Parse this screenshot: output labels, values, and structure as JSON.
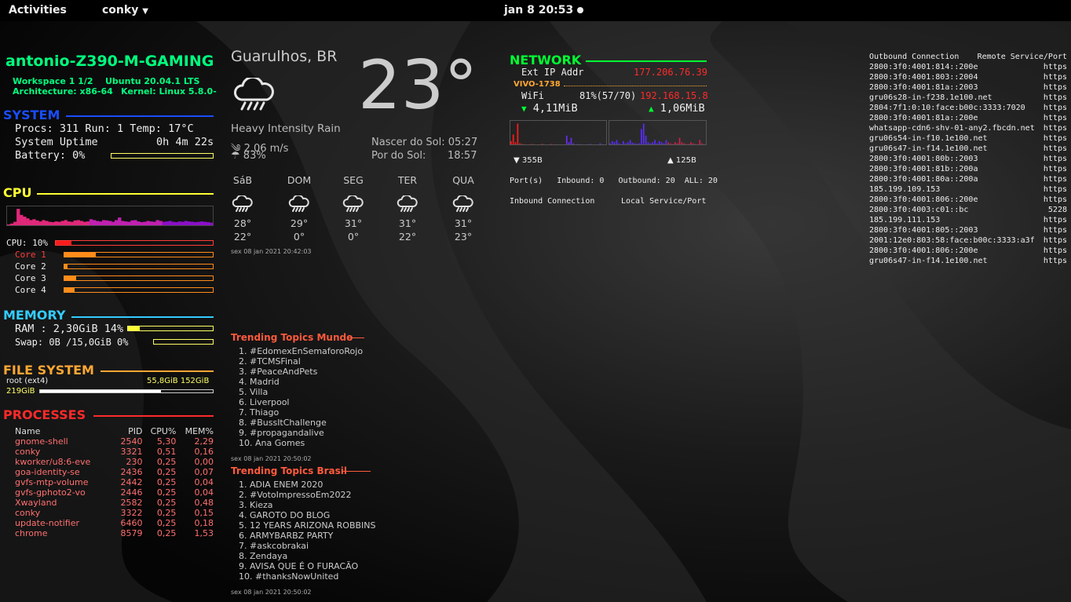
{
  "topbar": {
    "activities": "Activities",
    "app_menu": "conky",
    "clock": "jan 8  20:53"
  },
  "system": {
    "hostname": "antonio-Z390-M-GAMING",
    "workspace": "Workspace 1 1/2",
    "distro": "Ubuntu 20.04.1 LTS",
    "arch": "Architecture: x86-64",
    "kernel": "Kernel: Linux 5.8.0-",
    "heading": "SYSTEM",
    "procs": "Procs: 311  Run: 1 Temp: 17°C",
    "uptime_label": "System Uptime",
    "uptime_value": "0h 4m 22s",
    "battery": "Battery: 0%",
    "battery_fraction": 0.0
  },
  "cpu": {
    "heading": "CPU",
    "total_label": "CPU: 10%",
    "total_fraction": 0.1,
    "cores": [
      {
        "label": "Core 1",
        "fraction": 0.21
      },
      {
        "label": "Core 2",
        "fraction": 0.02
      },
      {
        "label": "Core 3",
        "fraction": 0.08
      },
      {
        "label": "Core 4",
        "fraction": 0.07
      }
    ]
  },
  "memory": {
    "heading": "MEMORY",
    "ram": "RAM : 2,30GiB 14%",
    "ram_fraction": 0.14,
    "swap": "Swap: 0B  /15,0GiB 0%",
    "swap_fraction": 0.0
  },
  "filesystem": {
    "heading": "FILE SYSTEM",
    "root": "root (ext4)",
    "usage": "55,8GiB 152GiB",
    "free": "219GiB",
    "fraction": 0.7
  },
  "processes": {
    "heading": "PROCESSES",
    "columns": [
      "Name",
      "PID",
      "CPU%",
      "MEM%"
    ],
    "rows": [
      [
        "gnome-shell",
        "2540",
        "5,30",
        "2,29"
      ],
      [
        "conky",
        "3321",
        "0,51",
        "0,16"
      ],
      [
        "kworker/u8:6-eve",
        "230",
        "0,25",
        "0,00"
      ],
      [
        "goa-identity-se",
        "2436",
        "0,25",
        "0,07"
      ],
      [
        "gvfs-mtp-volume",
        "2442",
        "0,25",
        "0,04"
      ],
      [
        "gvfs-gphoto2-vo",
        "2446",
        "0,25",
        "0,04"
      ],
      [
        "Xwayland",
        "2582",
        "0,25",
        "0,48"
      ],
      [
        "conky",
        "3322",
        "0,25",
        "0,15"
      ],
      [
        "update-notifier",
        "6460",
        "0,25",
        "0,18"
      ],
      [
        "chrome",
        "8579",
        "0,25",
        "1,53"
      ]
    ]
  },
  "weather": {
    "city": "Guarulhos, BR",
    "temp": "23°",
    "condition": "Heavy Intensity Rain",
    "wind": "2.06 m/s",
    "humidity": "83%",
    "sunrise": "Nascer do Sol: 05:27",
    "sunset_label": "Por do Sol:",
    "sunset_time": "18:57",
    "forecast": [
      {
        "day": "SáB",
        "hi": "28°",
        "lo": "22°"
      },
      {
        "day": "DOM",
        "hi": "29°",
        "lo": "0°"
      },
      {
        "day": "SEG",
        "hi": "31°",
        "lo": "0°"
      },
      {
        "day": "TER",
        "hi": "31°",
        "lo": "22°"
      },
      {
        "day": "QUA",
        "hi": "31°",
        "lo": "23°"
      }
    ],
    "updated": "sex 08 jan 2021 20:42:03"
  },
  "trending_world": {
    "title": "Trending Topics Mundo",
    "items": [
      "1. #EdomexEnSemaforoRojo",
      "2. #TCMSFinal",
      "3. #PeaceAndPets",
      "4. Madrid",
      "5. Villa",
      "6. Liverpool",
      "7. Thiago",
      "8. #BussItChallenge",
      "9. #propagandalive",
      "10. Ana Gomes"
    ],
    "updated": "sex 08 jan 2021 20:50:02"
  },
  "trending_brazil": {
    "title": "Trending Topics Brasil",
    "items": [
      "1. ADIA ENEM 2020",
      "2. #VotoImpressoEm2022",
      "3. Kieza",
      "4. GAROTO DO BLOG",
      "5. 12 YEARS ARIZONA ROBBINS",
      "6. ARMYBARBZ PARTY",
      "7. #askcobrakai",
      "8. Zendaya",
      "9. AVISA QUE É O FURACÃO",
      "10. #thanksNowUnited"
    ],
    "updated": "sex 08 jan 2021 20:50:02"
  },
  "network": {
    "heading": "NETWORK",
    "ext_ip_label": "Ext IP Addr",
    "ext_ip": "177.206.76.39",
    "ssid": "VIVO-1738",
    "wifi_label": "WiFi",
    "wifi_quality": "81%(57/70)",
    "local_ip": "192.168.15.8",
    "down_total": "4,11MiB",
    "up_total": "1,06MiB",
    "down_rate": "355B",
    "up_rate": "125B",
    "ports": "Port(s)   Inbound: 0   Outbound: 20  ALL: 20",
    "inbound_label": "Inbound Connection",
    "local_service_label": "Local Service/Port",
    "down_graph": [
      0.15,
      0.45,
      0.1,
      0.95,
      0.05,
      0.02,
      0.01,
      0,
      0,
      0.02,
      0.01,
      0,
      0,
      0,
      0.03,
      0,
      0,
      0,
      0.02,
      0,
      0.01,
      0,
      0,
      0,
      0,
      0.4,
      0.1,
      0.3,
      0.05,
      0,
      0.02,
      0.01,
      0,
      0,
      0,
      0.02,
      0.01,
      0,
      0,
      0,
      0.05,
      0.01,
      0
    ],
    "up_graph": [
      0.05,
      0.15,
      0.1,
      0.2,
      0.05,
      0.02,
      0.15,
      0.05,
      0.1,
      0.2,
      0.08,
      0.05,
      0.03,
      0.05,
      0.7,
      0.95,
      0.4,
      0.1,
      0.05,
      0.1,
      0.2,
      0.05,
      0.15,
      0.1,
      0.05,
      0.2,
      0.1,
      0.05,
      0.02,
      0.1,
      0.05,
      0.3,
      0.1,
      0.05,
      0.02,
      0.02,
      0.1,
      0.05,
      0.02,
      0.01,
      0.2,
      0.05,
      0.01
    ]
  },
  "connections": {
    "outbound_label": "Outbound Connection",
    "remote_label": "Remote Service/Port",
    "rows": [
      [
        "2800:3f0:4001:814::200e",
        "https"
      ],
      [
        "2800:3f0:4001:803::2004",
        "https"
      ],
      [
        "2800:3f0:4001:81a::2003",
        "https"
      ],
      [
        "gru06s28-in-f238.1e100.net",
        "https"
      ],
      [
        "2804:7f1:0:10:face:b00c:3333:7020",
        "https"
      ],
      [
        "2800:3f0:4001:81a::200e",
        "https"
      ],
      [
        "whatsapp-cdn6-shv-01-any2.fbcdn.net",
        "https"
      ],
      [
        "gru06s54-in-f10.1e100.net",
        "https"
      ],
      [
        "gru06s47-in-f14.1e100.net",
        "https"
      ],
      [
        "2800:3f0:4001:80b::2003",
        "https"
      ],
      [
        "2800:3f0:4001:81b::200a",
        "https"
      ],
      [
        "2800:3f0:4001:80a::200a",
        "https"
      ],
      [
        "185.199.109.153",
        "https"
      ],
      [
        "2800:3f0:4001:806::200e",
        "https"
      ],
      [
        "2800:3f0:4003:c01::bc",
        "5228"
      ],
      [
        "185.199.111.153",
        "https"
      ],
      [
        "2800:3f0:4001:805::2003",
        "https"
      ],
      [
        "2001:12e0:803:58:face:b00c:3333:a3f",
        "https"
      ],
      [
        "2800:3f0:4001:806::200e",
        "https"
      ],
      [
        "gru06s47-in-f14.1e100.net",
        "https"
      ]
    ]
  },
  "cpu_graph": [
    0.05,
    0.1,
    0.2,
    0.95,
    0.6,
    0.5,
    0.4,
    0.3,
    0.35,
    0.28,
    0.22,
    0.3,
    0.25,
    0.2,
    0.18,
    0.22,
    0.2,
    0.25,
    0.3,
    0.22,
    0.2,
    0.28,
    0.3,
    0.25,
    0.2,
    0.22,
    0.35,
    0.3,
    0.25,
    0.22,
    0.3,
    0.28,
    0.25,
    0.2,
    0.3,
    0.45,
    0.25,
    0.22,
    0.2,
    0.28,
    0.3,
    0.22,
    0.18,
    0.2,
    0.25,
    0.22,
    0.2,
    0.3,
    0.25,
    0.2,
    0.22,
    0.25,
    0.2,
    0.18,
    0.22,
    0.2,
    0.25,
    0.22,
    0.2,
    0.18,
    0.2,
    0.22,
    0.2,
    0.18,
    0.15
  ]
}
